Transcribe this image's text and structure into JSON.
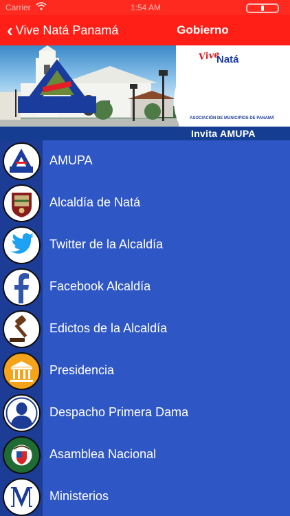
{
  "status_bar": {
    "carrier": "Carrier",
    "time": "1:54 AM"
  },
  "nav": {
    "back_label": "Vive Natá Panamá",
    "title": "Gobierno"
  },
  "banner": {
    "brand_vive": "Vive",
    "brand_nata": "Natá",
    "brand_amupa": "AMUPA",
    "brand_subtitle": "ASOCIACIÓN DE MUNICIPIOS DE PANAMÁ",
    "invite_label": "Invita AMUPA"
  },
  "list": {
    "items": [
      {
        "label": "AMUPA",
        "icon": "amupa-logo-icon"
      },
      {
        "label": "Alcaldía de Natá",
        "icon": "municipal-crest-icon"
      },
      {
        "label": "Twitter de la Alcaldía",
        "icon": "twitter-icon"
      },
      {
        "label": "Facebook Alcaldía",
        "icon": "facebook-icon"
      },
      {
        "label": "Edictos de la Alcaldía",
        "icon": "gavel-icon"
      },
      {
        "label": "Presidencia",
        "icon": "government-building-icon"
      },
      {
        "label": "Despacho Primera Dama",
        "icon": "person-silhouette-icon"
      },
      {
        "label": "Asamblea Nacional",
        "icon": "national-assembly-seal-icon"
      },
      {
        "label": "Ministerios",
        "icon": "letter-m-icon"
      }
    ]
  },
  "colors": {
    "nav_red": "#ff1f17",
    "list_blue": "#2e56c4",
    "icon_cell_blue": "#1c3c95",
    "twitter_blue": "#1da1f2",
    "facebook_blue": "#2f56a8",
    "presidency_orange": "#f5a31a"
  }
}
